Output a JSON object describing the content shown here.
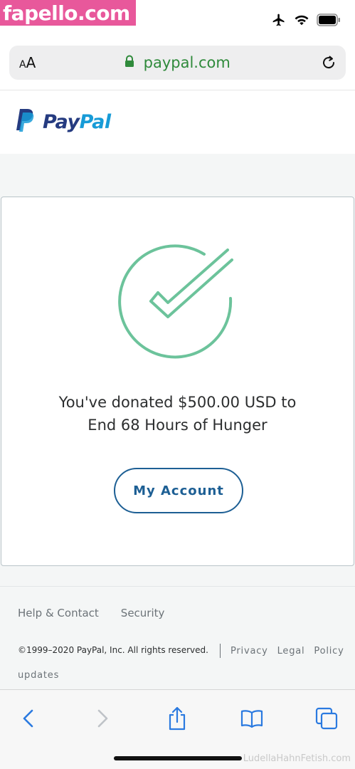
{
  "watermark": {
    "top": "fapello.com",
    "bottom": "LudellaHahnFetish.com"
  },
  "status_bar": {
    "icons": [
      "airplane-icon",
      "wifi-icon",
      "battery-icon"
    ]
  },
  "browser": {
    "text_size_label_small": "A",
    "text_size_label_large": "A",
    "url": "paypal.com",
    "secure": true,
    "url_color": "#2f8a3b"
  },
  "header": {
    "brand_pay": "Pay",
    "brand_pal": "Pal"
  },
  "confirmation": {
    "icon": "checkmark-circle-icon",
    "icon_color": "#6cc39b",
    "message_line1": "You've donated $500.00 USD to",
    "message_line2": "End 68 Hours of Hunger",
    "button_label": "My Account"
  },
  "footer": {
    "links": [
      "Help & Contact",
      "Security"
    ],
    "copyright": "©1999–2020 PayPal, Inc. All rights reserved.",
    "legal_links": [
      "Privacy",
      "Legal",
      "Policy"
    ],
    "legal_updates": "updates"
  },
  "toolbar": {
    "buttons": [
      "back-icon",
      "forward-icon",
      "share-icon",
      "bookmarks-icon",
      "tabs-icon"
    ]
  },
  "colors": {
    "paypal_dark": "#253b80",
    "paypal_light": "#179bd7",
    "button_blue": "#1d5f94",
    "ios_blue": "#2b7ae0"
  }
}
